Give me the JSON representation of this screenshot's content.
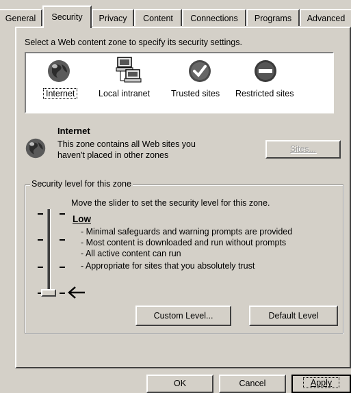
{
  "tabs": [
    {
      "label": "General"
    },
    {
      "label": "Security"
    },
    {
      "label": "Privacy"
    },
    {
      "label": "Content"
    },
    {
      "label": "Connections"
    },
    {
      "label": "Programs"
    },
    {
      "label": "Advanced"
    }
  ],
  "zone_prompt": "Select a Web content zone to specify its security settings.",
  "zones": [
    {
      "label": "Internet",
      "icon": "globe-icon"
    },
    {
      "label": "Local intranet",
      "icon": "computer-network-icon"
    },
    {
      "label": "Trusted sites",
      "icon": "checkmark-icon"
    },
    {
      "label": "Restricted sites",
      "icon": "restricted-icon"
    }
  ],
  "zone_info": {
    "title": "Internet",
    "line1": "This zone contains all Web sites you",
    "line2": "haven't placed in other zones",
    "sites_button": "Sites..."
  },
  "security": {
    "group_label": "Security level for this zone",
    "instruction": "Move the slider to set the security level for this zone.",
    "level_name": "Low",
    "bullets": [
      "- Minimal safeguards and warning prompts are provided",
      "- Most content is downloaded and run without prompts",
      "- All active content can run",
      "- Appropriate for sites that you absolutely trust"
    ],
    "custom_button": "Custom Level...",
    "default_button": "Default Level"
  },
  "footer": {
    "ok": "OK",
    "cancel": "Cancel",
    "apply": "Apply"
  },
  "colors": {
    "face": "#d4d0c8",
    "shadow": "#808080",
    "dark": "#404040",
    "highlight": "#ffffff"
  }
}
